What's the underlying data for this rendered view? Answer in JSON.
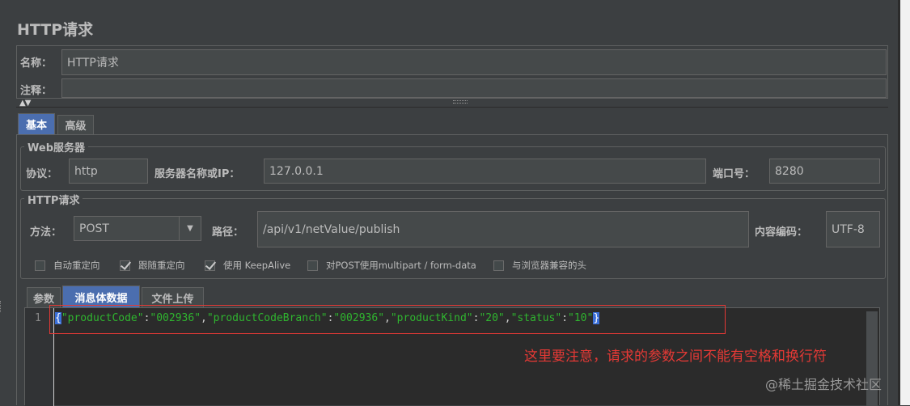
{
  "page": {
    "title": "HTTP请求"
  },
  "name_row": {
    "label": "名称：",
    "value": "HTTP请求"
  },
  "comment_row": {
    "label": "注释：",
    "value": ""
  },
  "tabs": [
    {
      "label": "基本",
      "active": true
    },
    {
      "label": "高级",
      "active": false
    }
  ],
  "web_server": {
    "legend": "Web服务器",
    "protocol_label": "协议：",
    "protocol_value": "http",
    "server_label": "服务器名称或IP：",
    "server_value": "127.0.0.1",
    "port_label": "端口号：",
    "port_value": "8280"
  },
  "http_request": {
    "legend": "HTTP请求",
    "method_label": "方法：",
    "method_value": "POST",
    "path_label": "路径：",
    "path_value": "/api/v1/netValue/publish",
    "encoding_label": "内容编码：",
    "encoding_value": "UTF-8"
  },
  "options": [
    {
      "label": "自动重定向",
      "checked": false
    },
    {
      "label": "跟随重定向",
      "checked": true
    },
    {
      "label": "使用 KeepAlive",
      "checked": true
    },
    {
      "label": "对POST使用multipart / form-data",
      "checked": false
    },
    {
      "label": "与浏览器兼容的头",
      "checked": false
    }
  ],
  "body_tabs": [
    {
      "label": "参数",
      "active": false
    },
    {
      "label": "消息体数据",
      "active": true
    },
    {
      "label": "文件上传",
      "active": false
    }
  ],
  "editor": {
    "line_number": "1",
    "tokens": {
      "open": "{",
      "k1": "\"productCode\"",
      "c1": ":",
      "v1": "\"002936\"",
      "s1": ",",
      "k2": "\"productCodeBranch\"",
      "c2": ":",
      "v2": "\"002936\"",
      "s2": ",",
      "k3": "\"productKind\"",
      "c3": ":",
      "v3": "\"20\"",
      "s3": ",",
      "k4": "\"status\"",
      "c4": ":",
      "v4": "\"10\"",
      "close": "}"
    }
  },
  "annotation": {
    "text": "这里要注意，请求的参数之间不能有空格和换行符",
    "color": "#e53935"
  },
  "watermark": "@稀土掘金技术社区",
  "colors": {
    "accent": "#4b6eaf",
    "string_green": "#6a8759",
    "background": "#3c3f41"
  }
}
